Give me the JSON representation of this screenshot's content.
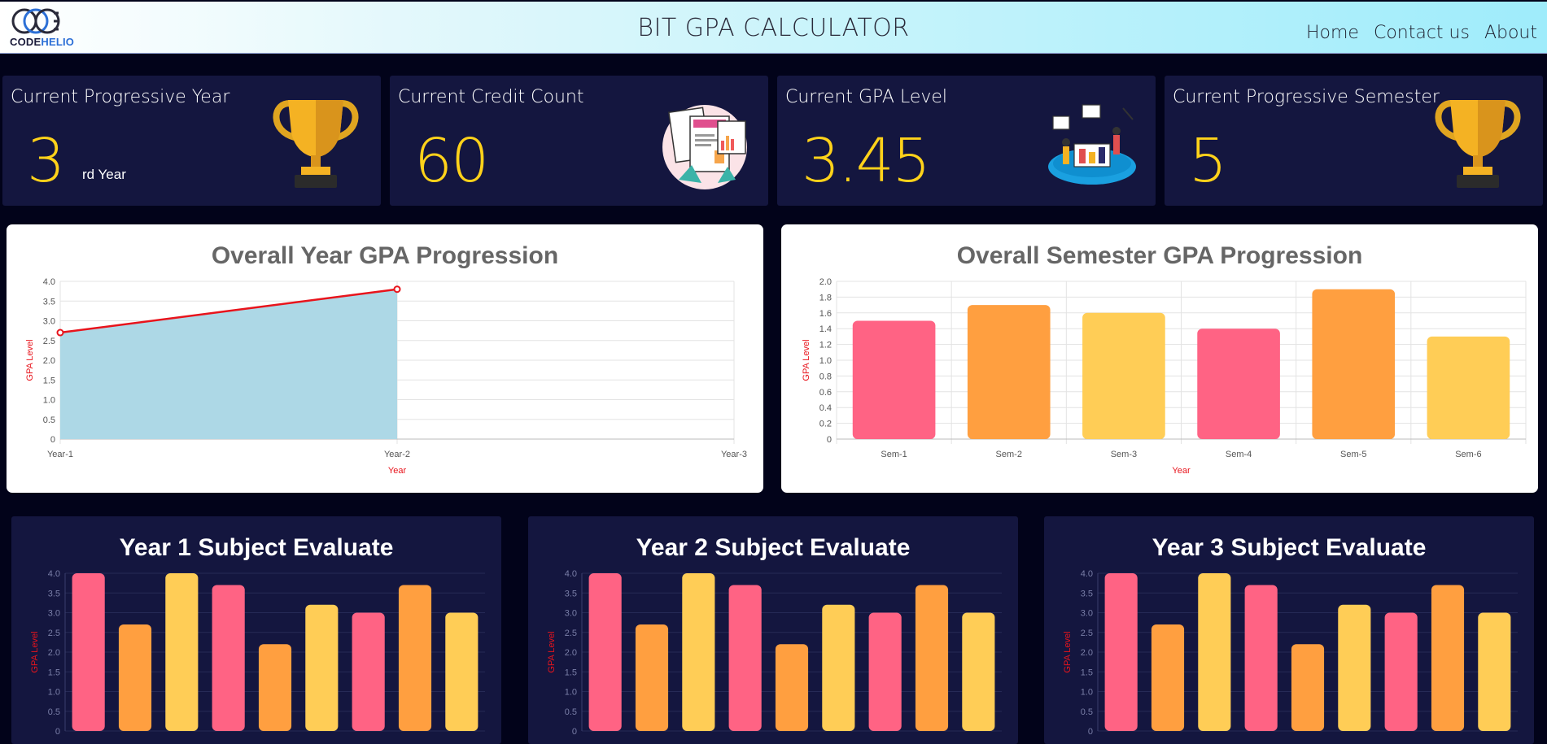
{
  "header": {
    "logo_text_a": "CODE",
    "logo_text_b": "HELIO",
    "title": "BIT GPA CALCULATOR",
    "nav": [
      "Home",
      "Contact us",
      "About"
    ]
  },
  "cards": [
    {
      "title": "Current Progressive Year",
      "value": "3",
      "suffix": "rd Year",
      "icon": "trophy-icon"
    },
    {
      "title": "Current Credit Count",
      "value": "60",
      "suffix": "",
      "icon": "credit-illustration-icon"
    },
    {
      "title": "Current GPA Level",
      "value": "3.45",
      "suffix": "",
      "icon": "team-illustration-icon"
    },
    {
      "title": "Current Progressive Semester",
      "value": "5",
      "suffix": "",
      "icon": "trophy-icon"
    }
  ],
  "colors": {
    "pink": "#ff6384",
    "orange": "#ff9f40",
    "yellow": "#ffcd56",
    "area_fill": "#add8e6",
    "line": "#e8141c",
    "accent_yellow": "#ffd21a"
  },
  "chart_data": [
    {
      "type": "area",
      "title": "Overall Year GPA Progression",
      "categories": [
        "Year-1",
        "Year-2",
        "Year-3"
      ],
      "values": [
        2.7,
        3.8,
        null
      ],
      "xlabel": "Year",
      "ylabel": "GPA Level",
      "ylim": [
        0,
        4.0
      ],
      "yticks": [
        "0",
        "0.5",
        "1.0",
        "1.5",
        "2.0",
        "2.5",
        "3.0",
        "3.5",
        "4.0"
      ],
      "grid": true
    },
    {
      "type": "bar",
      "title": "Overall Semester GPA Progression",
      "categories": [
        "Sem-1",
        "Sem-2",
        "Sem-3",
        "Sem-4",
        "Sem-5",
        "Sem-6"
      ],
      "values": [
        1.5,
        1.7,
        1.6,
        1.4,
        1.9,
        1.3
      ],
      "xlabel": "Year",
      "ylabel": "GPA Level",
      "ylim": [
        0,
        2.0
      ],
      "yticks": [
        "0",
        "0.2",
        "0.4",
        "0.6",
        "0.8",
        "1.0",
        "1.2",
        "1.4",
        "1.6",
        "1.8",
        "2.0"
      ],
      "grid": true
    },
    {
      "type": "bar",
      "title": "Year 1 Subject Evaluate",
      "values": [
        4.0,
        2.7,
        4.0,
        3.7,
        2.2,
        3.2,
        3.0,
        3.7,
        3.0
      ],
      "ylabel": "GPA Level",
      "ylim": [
        0,
        4.0
      ],
      "yticks": [
        "0",
        "0.5",
        "1.0",
        "1.5",
        "2.0",
        "2.5",
        "3.0",
        "3.5",
        "4.0"
      ]
    },
    {
      "type": "bar",
      "title": "Year 2 Subject Evaluate",
      "values": [
        4.0,
        2.7,
        4.0,
        3.7,
        2.2,
        3.2,
        3.0,
        3.7,
        3.0
      ],
      "ylabel": "GPA Level",
      "ylim": [
        0,
        4.0
      ],
      "yticks": [
        "0",
        "0.5",
        "1.0",
        "1.5",
        "2.0",
        "2.5",
        "3.0",
        "3.5",
        "4.0"
      ]
    },
    {
      "type": "bar",
      "title": "Year 3 Subject Evaluate",
      "values": [
        4.0,
        2.7,
        4.0,
        3.7,
        2.2,
        3.2,
        3.0,
        3.7,
        3.0
      ],
      "ylabel": "GPA Level",
      "ylim": [
        0,
        4.0
      ],
      "yticks": [
        "0",
        "0.5",
        "1.0",
        "1.5",
        "2.0",
        "2.5",
        "3.0",
        "3.5",
        "4.0"
      ]
    }
  ]
}
